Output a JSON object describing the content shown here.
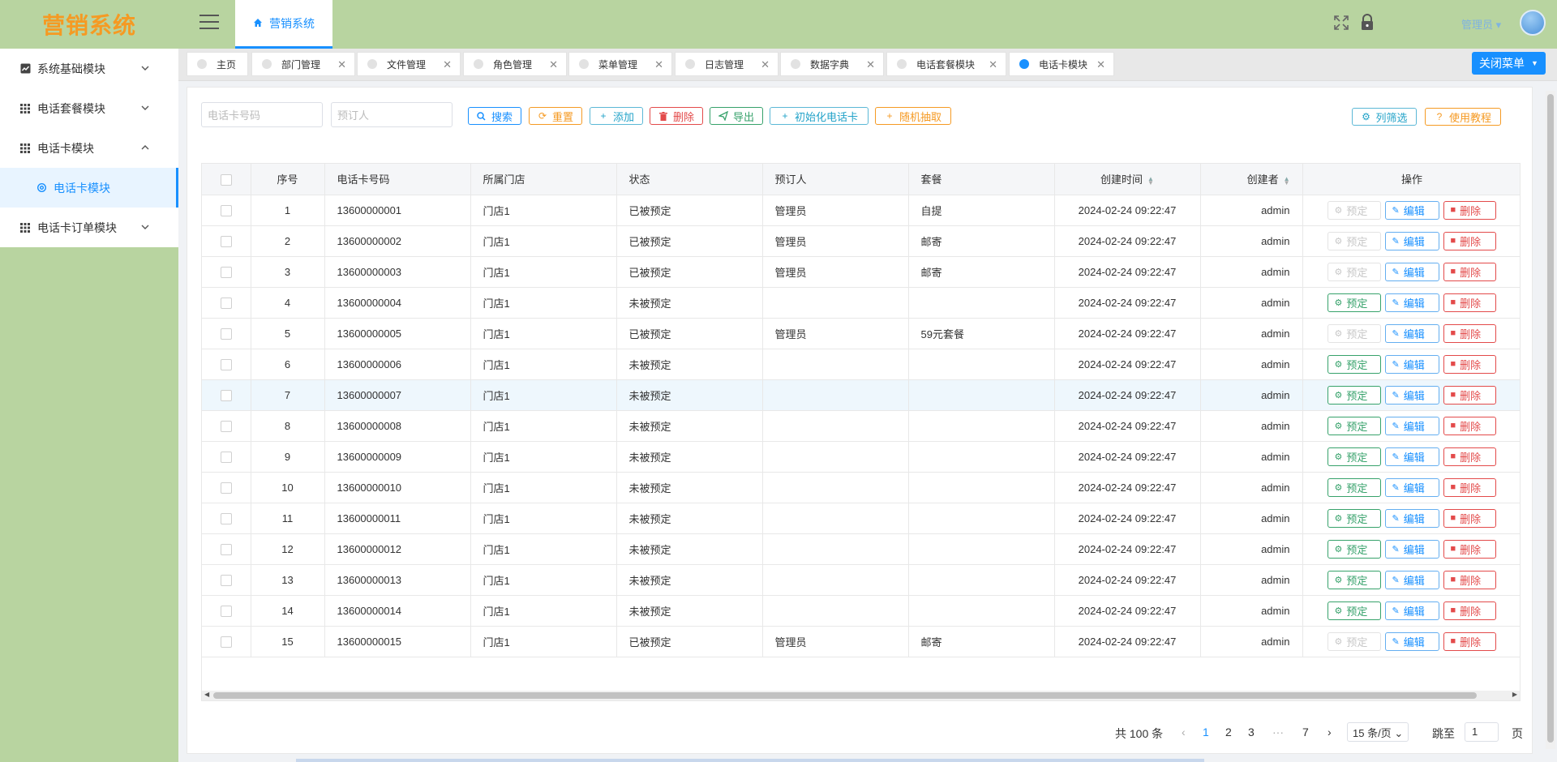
{
  "app": {
    "logo": "营销系统",
    "home_tab": "营销系统",
    "admin_label": "管理员 ▾"
  },
  "sidebar": {
    "items": [
      {
        "label": "系统基础模块",
        "icon": "chart-icon",
        "expanded": false
      },
      {
        "label": "电话套餐模块",
        "icon": "grid-icon",
        "expanded": false
      },
      {
        "label": "电话卡模块",
        "icon": "grid-icon",
        "expanded": true
      },
      {
        "label": "电话卡模块",
        "icon": "gear-icon",
        "sub": true
      },
      {
        "label": "电话卡订单模块",
        "icon": "grid-icon",
        "expanded": false
      }
    ]
  },
  "tabs": [
    {
      "label": "主页",
      "closable": false,
      "active": false
    },
    {
      "label": "部门管理",
      "closable": true,
      "active": false
    },
    {
      "label": "文件管理",
      "closable": true,
      "active": false
    },
    {
      "label": "角色管理",
      "closable": true,
      "active": false
    },
    {
      "label": "菜单管理",
      "closable": true,
      "active": false
    },
    {
      "label": "日志管理",
      "closable": true,
      "active": false
    },
    {
      "label": "数据字典",
      "closable": true,
      "active": false
    },
    {
      "label": "电话套餐模块",
      "closable": true,
      "active": false
    },
    {
      "label": "电话卡模块",
      "closable": true,
      "active": true
    }
  ],
  "close_menu_label": "关闭菜单",
  "toolbar": {
    "phone_placeholder": "电话卡号码",
    "reserver_placeholder": "预订人",
    "search": "搜索",
    "reset": "重置",
    "add": "添加",
    "delete": "删除",
    "export": "导出",
    "init": "初始化电话卡",
    "random": "随机抽取",
    "column_filter": "列筛选",
    "tutorial": "使用教程"
  },
  "table": {
    "headers": [
      "序号",
      "电话卡号码",
      "所属门店",
      "状态",
      "预订人",
      "套餐",
      "创建时间",
      "创建者",
      "操作"
    ],
    "op_labels": {
      "reserve": "预定",
      "edit": "编辑",
      "delete": "删除"
    },
    "rows": [
      {
        "no": "1",
        "phone": "13600000001",
        "store": "门店1",
        "status": "已被预定",
        "reserver": "管理员",
        "plan": "自提",
        "created": "2024-02-24 09:22:47",
        "creator": "admin",
        "reserved": true
      },
      {
        "no": "2",
        "phone": "13600000002",
        "store": "门店1",
        "status": "已被预定",
        "reserver": "管理员",
        "plan": "邮寄",
        "created": "2024-02-24 09:22:47",
        "creator": "admin",
        "reserved": true
      },
      {
        "no": "3",
        "phone": "13600000003",
        "store": "门店1",
        "status": "已被预定",
        "reserver": "管理员",
        "plan": "邮寄",
        "created": "2024-02-24 09:22:47",
        "creator": "admin",
        "reserved": true
      },
      {
        "no": "4",
        "phone": "13600000004",
        "store": "门店1",
        "status": "未被预定",
        "reserver": "",
        "plan": "",
        "created": "2024-02-24 09:22:47",
        "creator": "admin",
        "reserved": false
      },
      {
        "no": "5",
        "phone": "13600000005",
        "store": "门店1",
        "status": "已被预定",
        "reserver": "管理员",
        "plan": "59元套餐",
        "created": "2024-02-24 09:22:47",
        "creator": "admin",
        "reserved": true
      },
      {
        "no": "6",
        "phone": "13600000006",
        "store": "门店1",
        "status": "未被预定",
        "reserver": "",
        "plan": "",
        "created": "2024-02-24 09:22:47",
        "creator": "admin",
        "reserved": false
      },
      {
        "no": "7",
        "phone": "13600000007",
        "store": "门店1",
        "status": "未被预定",
        "reserver": "",
        "plan": "",
        "created": "2024-02-24 09:22:47",
        "creator": "admin",
        "reserved": false,
        "highlight": true
      },
      {
        "no": "8",
        "phone": "13600000008",
        "store": "门店1",
        "status": "未被预定",
        "reserver": "",
        "plan": "",
        "created": "2024-02-24 09:22:47",
        "creator": "admin",
        "reserved": false
      },
      {
        "no": "9",
        "phone": "13600000009",
        "store": "门店1",
        "status": "未被预定",
        "reserver": "",
        "plan": "",
        "created": "2024-02-24 09:22:47",
        "creator": "admin",
        "reserved": false
      },
      {
        "no": "10",
        "phone": "13600000010",
        "store": "门店1",
        "status": "未被预定",
        "reserver": "",
        "plan": "",
        "created": "2024-02-24 09:22:47",
        "creator": "admin",
        "reserved": false
      },
      {
        "no": "11",
        "phone": "13600000011",
        "store": "门店1",
        "status": "未被预定",
        "reserver": "",
        "plan": "",
        "created": "2024-02-24 09:22:47",
        "creator": "admin",
        "reserved": false
      },
      {
        "no": "12",
        "phone": "13600000012",
        "store": "门店1",
        "status": "未被预定",
        "reserver": "",
        "plan": "",
        "created": "2024-02-24 09:22:47",
        "creator": "admin",
        "reserved": false
      },
      {
        "no": "13",
        "phone": "13600000013",
        "store": "门店1",
        "status": "未被预定",
        "reserver": "",
        "plan": "",
        "created": "2024-02-24 09:22:47",
        "creator": "admin",
        "reserved": false
      },
      {
        "no": "14",
        "phone": "13600000014",
        "store": "门店1",
        "status": "未被预定",
        "reserver": "",
        "plan": "",
        "created": "2024-02-24 09:22:47",
        "creator": "admin",
        "reserved": false
      },
      {
        "no": "15",
        "phone": "13600000015",
        "store": "门店1",
        "status": "已被预定",
        "reserver": "管理员",
        "plan": "邮寄",
        "created": "2024-02-24 09:22:47",
        "creator": "admin",
        "reserved": true
      }
    ]
  },
  "pagination": {
    "total": "共 100 条",
    "pages": [
      "1",
      "2",
      "3",
      "···",
      "7"
    ],
    "current": "1",
    "page_size": "15 条/页",
    "goto_label": "跳至",
    "goto_value": "1",
    "page_suffix": "页"
  },
  "colors": {
    "accent": "#1890ff",
    "header_bg": "#b8d4a0",
    "logo": "#f59a23"
  }
}
